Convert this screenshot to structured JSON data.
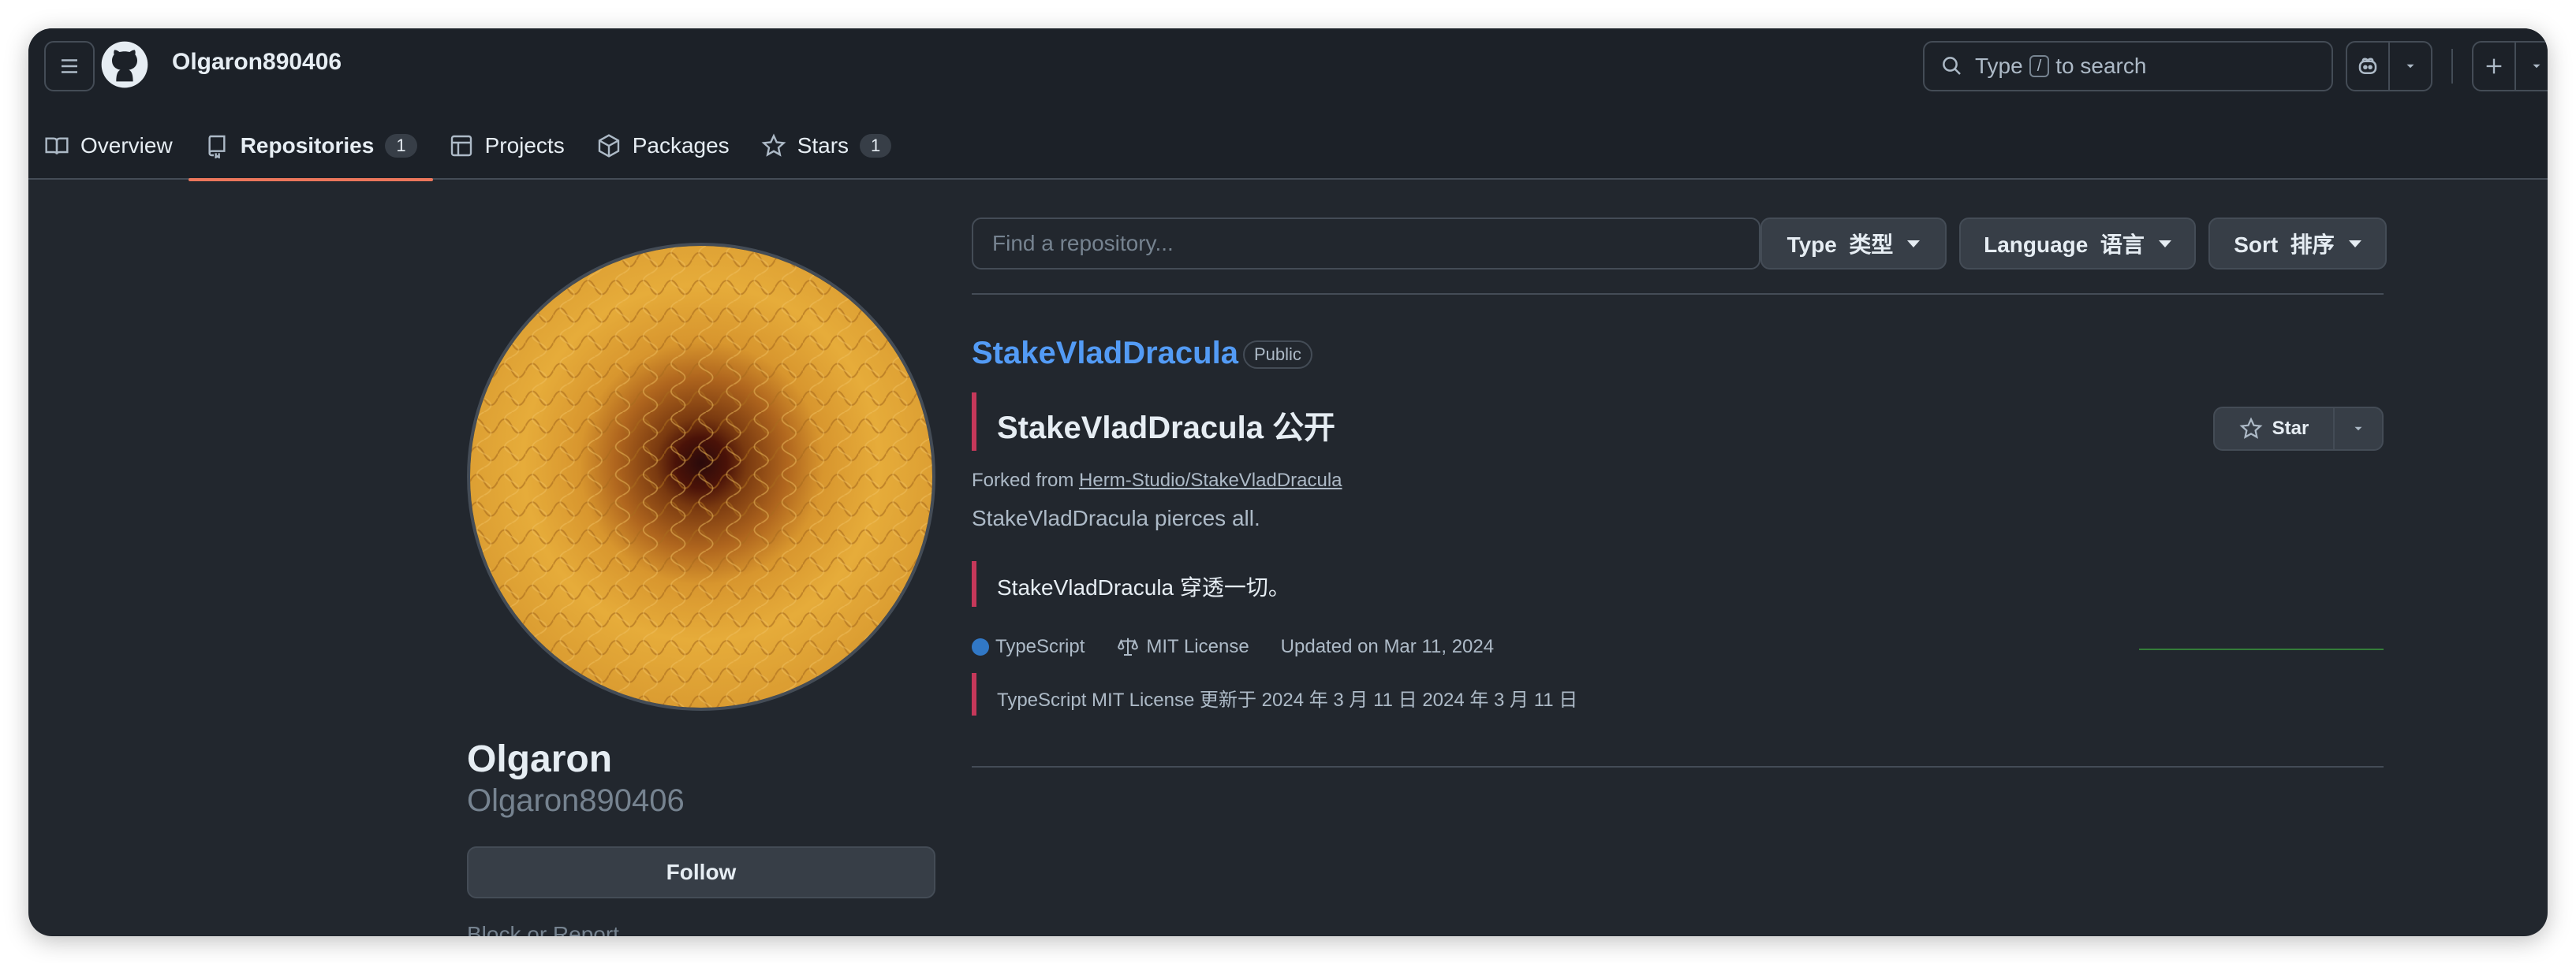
{
  "header": {
    "username": "Olgaron890406",
    "search": {
      "prefix": "Type",
      "key": "/",
      "suffix": "to search"
    }
  },
  "tabs": [
    {
      "label": "Overview",
      "count": null,
      "icon": "book-icon"
    },
    {
      "label": "Repositories",
      "count": "1",
      "icon": "repo-icon"
    },
    {
      "label": "Projects",
      "count": null,
      "icon": "table-icon"
    },
    {
      "label": "Packages",
      "count": null,
      "icon": "package-icon"
    },
    {
      "label": "Stars",
      "count": "1",
      "icon": "star-icon"
    }
  ],
  "profile": {
    "display_name": "Olgaron",
    "login": "Olgaron890406",
    "follow_label": "Follow",
    "block_label": "Block or Report"
  },
  "filters": {
    "find_placeholder": "Find a repository...",
    "type_label": "Type  类型",
    "language_label": "Language  语言",
    "sort_label": "Sort  排序"
  },
  "repo": {
    "name": "StakeVladDracula",
    "visibility": "Public",
    "translated_title": "StakeVladDracula 公开",
    "forked_prefix": "Forked from",
    "forked_from": "Herm-Studio/StakeVladDracula",
    "description": "StakeVladDracula pierces all.",
    "translated_description": "StakeVladDracula 穿透一切。",
    "language": "TypeScript",
    "language_color": "#3178c6",
    "license": "MIT License",
    "updated": "Updated on Mar 11, 2024",
    "translated_meta": "TypeScript MIT License 更新于 2024 年 3 月 11 日 2024 年 3 月 11 日",
    "star_label": "Star"
  },
  "colors": {
    "accent_tab": "#ec775c",
    "link": "#539bf5",
    "quote_bar": "#c6385a"
  }
}
